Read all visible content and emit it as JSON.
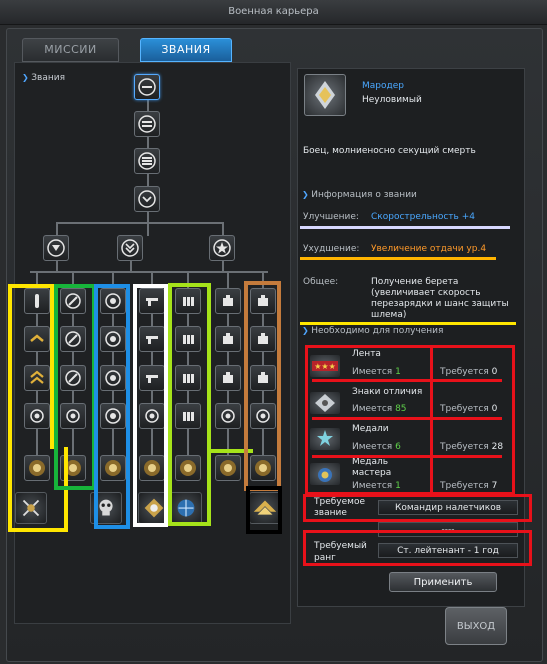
{
  "window": {
    "title": "Военная карьера"
  },
  "tabs": [
    {
      "label": "МИССИИ",
      "active": false
    },
    {
      "label": "ЗВАНИЯ",
      "active": true
    }
  ],
  "tree": {
    "heading": "Звания",
    "branches": [
      "yellow",
      "green",
      "blue",
      "white",
      "lime",
      "tan"
    ],
    "highlight_colors": {
      "yellow": "#ffe600",
      "green": "#17b43a",
      "blue": "#1e8fe6",
      "white": "#ffffff",
      "lime": "#a6e31a",
      "tan": "#c47b3c",
      "black": "#000000"
    }
  },
  "rank": {
    "name": "Мародер",
    "subtitle": "Неуловимый",
    "description": "Боец, молниеносно секущий смерть",
    "info_section": "Информация о звании",
    "improvement_label": "Улучшение:",
    "improvement_value": "Скорострельность +4",
    "worsening_label": "Ухудшение:",
    "worsening_value": "Увеличение отдачи ур.4",
    "general_label": "Общее:",
    "general_value": "Получение берета (увеличивает скорость перезарядки и шанс защиты шлема)"
  },
  "requirements": {
    "section_title": "Необходимо для получения",
    "items": [
      {
        "name": "Лента",
        "has_label": "Имеется",
        "has_value": "1",
        "need_label": "Требуется",
        "need_value": "0",
        "icon": "ribbon-icon"
      },
      {
        "name": "Знаки отличия",
        "has_label": "Имеется",
        "has_value": "85",
        "need_label": "Требуется",
        "need_value": "0",
        "icon": "insignia-icon"
      },
      {
        "name": "Медали",
        "has_label": "Имеется",
        "has_value": "6",
        "need_label": "Требуется",
        "need_value": "28",
        "icon": "medal-icon"
      },
      {
        "name": "Медаль мастера",
        "has_label": "Имеется",
        "has_value": "1",
        "need_label": "Требуется",
        "need_value": "7",
        "icon": "master-medal-icon"
      }
    ],
    "required_title_label": "Требуемое звание",
    "required_title_value": "Командир налетчиков",
    "blank_value": "----",
    "required_rank_label": "Требуемый ранг",
    "required_rank_value": "Ст. лейтенант - 1 год"
  },
  "buttons": {
    "apply": "Применить",
    "exit": "ВЫХОД"
  },
  "colors": {
    "accent": "#2b8fd8",
    "improvement": "#4aa8ff",
    "worsening": "#ff9a2a",
    "has_value": "#5fd04a",
    "annotation_red": "#e8111a"
  }
}
